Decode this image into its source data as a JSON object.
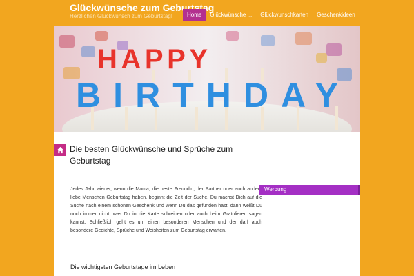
{
  "site": {
    "title": "Glückwünsche zum Geburtstag",
    "tagline": "Herzlichen Glückwunsch zum Geburtstag!"
  },
  "nav": {
    "items": [
      {
        "label": "Home"
      },
      {
        "label": "Glückwünsche ..."
      },
      {
        "label": "Glückwunschkarten"
      },
      {
        "label": "Geschenkideen"
      }
    ]
  },
  "hero": {
    "alt": "Happy Birthday Kerzen",
    "line1": "HAPPY",
    "line2": "BIRTHDAY"
  },
  "main": {
    "title": "Die besten Glückwünsche und Sprüche zum Geburtstag",
    "intro": "Jedes Jahr wieder, wenn die Mama, die beste Freundin, der Partner oder auch andere liebe Menschen Geburtstag haben, beginnt die Zeit der Suche. Du machst Dich auf die Suche nach einem schönen Geschenk und wenn Du das gefunden hast, dann weißt Du noch immer nicht, was Du in die Karte schreiben oder auch beim Gratulieren sagen kannst. Schließlich geht es um einen besonderen Menschen und der darf auch besondere Gedichte, Sprüche und Weisheiten zum Geburtstag erwarten.",
    "section_heading": "Die wichtigsten Geburtstage im Leben"
  },
  "sidebar": {
    "heading": "Werbung"
  },
  "colors": {
    "background": "#f2a61f",
    "accent": "#b32f8f",
    "sidebar_heading": "#a42fc4"
  },
  "icons": {
    "home_badge": "home-icon"
  }
}
